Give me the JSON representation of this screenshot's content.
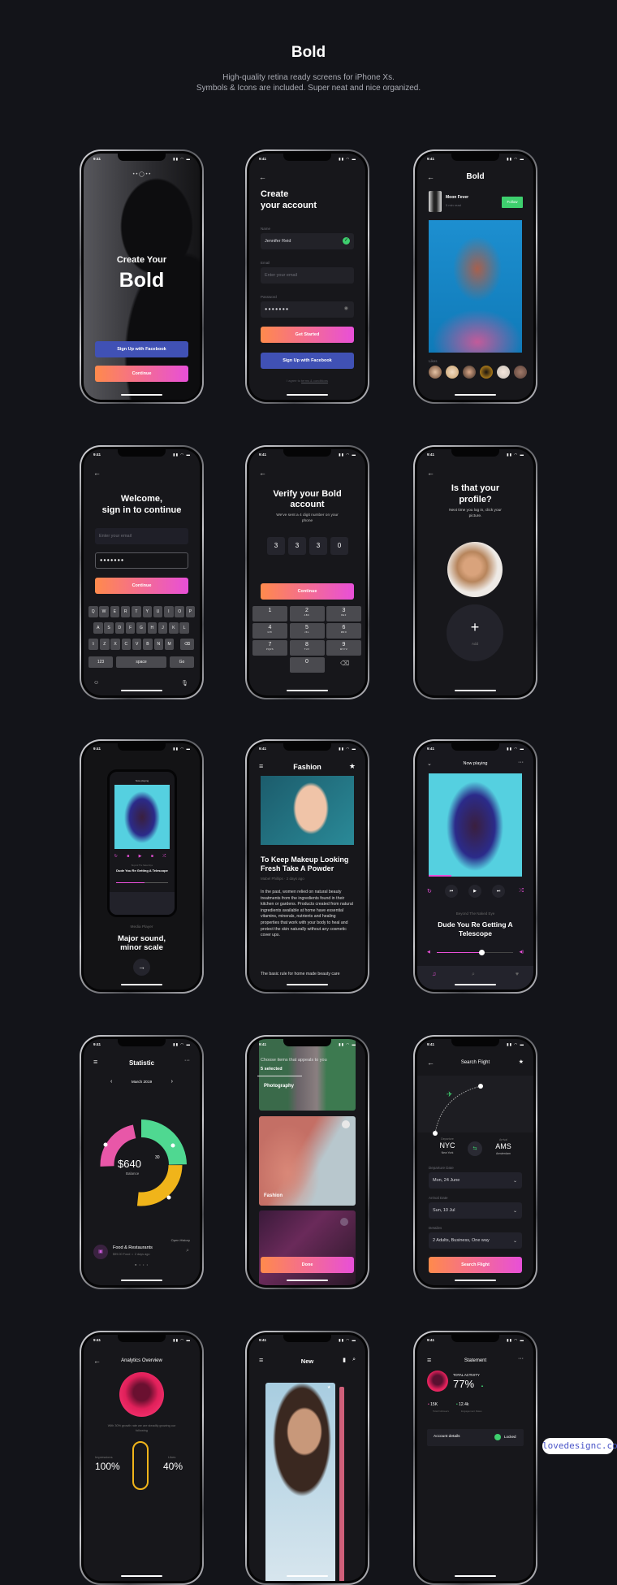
{
  "header": {
    "title": "Bold",
    "subtitle_1": "High-quality retina ready screens for iPhone Xs.",
    "subtitle_2": "Symbols & Icons are included. Super neat and nice organized."
  },
  "status_time": "9:41",
  "colors": {
    "background": "#131419",
    "accent_gradient_start": "#ff8a4c",
    "accent_gradient_end": "#e84fd8",
    "facebook": "#4051b5",
    "success": "#3ecf6e",
    "chart_pink": "#e857a8",
    "chart_green": "#4fd891",
    "chart_yellow": "#f0b41a"
  },
  "s1": {
    "title_small": "Create Your",
    "title_big": "Bold",
    "facebook_btn": "Sign Up with Facebook",
    "continue_btn": "Continue"
  },
  "s2": {
    "title_1": "Create",
    "title_2": "your account",
    "name_label": "Name",
    "name_value": "Jennifer Reid",
    "email_label": "Email",
    "email_placeholder": "Enter your email",
    "password_label": "Password",
    "password_value": "●●●●●●●",
    "get_started": "Get Started",
    "facebook_btn": "Sign Up with Facebook",
    "terms_prefix": "I agree to ",
    "terms_link": "terms & conditions"
  },
  "s3": {
    "title": "Bold",
    "author": "Moon Fever",
    "read_time": "5 min read",
    "follow": "Follow",
    "likes_label": "Likes"
  },
  "s4": {
    "title_1": "Welcome,",
    "title_2": "sign in to continue",
    "email_placeholder": "Enter your email",
    "password_value": "●●●●●●●",
    "continue_btn": "Continue",
    "keyboard": {
      "rows": [
        [
          "Q",
          "W",
          "E",
          "R",
          "T",
          "Y",
          "U",
          "I",
          "O",
          "P"
        ],
        [
          "A",
          "S",
          "D",
          "F",
          "G",
          "H",
          "J",
          "K",
          "L"
        ],
        [
          "Z",
          "X",
          "C",
          "V",
          "B",
          "N",
          "M"
        ]
      ],
      "num": "123",
      "space": "space",
      "go": "Go"
    }
  },
  "s5": {
    "title": "Verify your Bold account",
    "subtitle": "We've sent a 4 digit number on your phone",
    "code": [
      "3",
      "3",
      "3",
      "0"
    ],
    "continue_btn": "Continue",
    "numpad": [
      {
        "d": "1",
        "l": ""
      },
      {
        "d": "2",
        "l": "ABC"
      },
      {
        "d": "3",
        "l": "DEF"
      },
      {
        "d": "4",
        "l": "GHI"
      },
      {
        "d": "5",
        "l": "JKL"
      },
      {
        "d": "6",
        "l": "MNO"
      },
      {
        "d": "7",
        "l": "PQRS"
      },
      {
        "d": "8",
        "l": "TUV"
      },
      {
        "d": "9",
        "l": "WXYZ"
      },
      {
        "d": "0",
        "l": ""
      }
    ]
  },
  "s6": {
    "title_1": "Is that your",
    "title_2": "profile?",
    "subtitle": "Next time you log in, click your picture.",
    "add": "Add"
  },
  "s7": {
    "mini_header": "Now playing",
    "mini_artist": "Beyond The Naked Eye",
    "mini_song": "Dude You Re Getting A Telescope",
    "label": "Media Player",
    "title_1": "Major sound,",
    "title_2": "minor scale"
  },
  "s8": {
    "title": "Fashion",
    "article_title": "To Keep Makeup Looking Fresh Take A Powder",
    "meta": "Mabel Phillips · 2 days ago",
    "body": "In the past, women relied on natural beauty treatments from the ingredients found in their kitchen or gardens. Products created from natural ingredients available at home have essential vitamins, minerals, nutrients and healing properties that work with your body to heal and protect the skin naturally without any cosmetic cover ups.",
    "body_2": "The basic rule for home made beauty care"
  },
  "s9": {
    "header": "Now playing",
    "artist": "Beyond The Naked Eye",
    "song": "Dude You Re Getting A Telescope",
    "playback_progress": 0.24,
    "volume": 0.58
  },
  "s10": {
    "title": "Statistic",
    "month": "March 2019",
    "balance": "$640",
    "balance_cents": "30",
    "balance_label": "Balance",
    "open_history": "Open History",
    "item_title": "Food & Restaurants",
    "item_meta": "$99.00 Food  •  2 days ago"
  },
  "s11": {
    "prompt": "Choose items that appeals to you",
    "selected": "5 selected",
    "cat_1": "Photography",
    "cat_2": "Fashion",
    "done": "Done"
  },
  "s12": {
    "title": "Search Flight",
    "dep_label": "Departure",
    "dep_code": "NYC",
    "dep_city": "New York",
    "arr_label": "Arrival",
    "arr_code": "AMS",
    "arr_city": "Amsterdam",
    "dep_date_label": "Departure Date",
    "dep_date": "Mon, 24 June",
    "arr_date_label": "Arrival Date",
    "arr_date": "Sun, 10 Jul",
    "details_label": "Detailes",
    "details": "2 Adults, Business, One way",
    "search_btn": "Search Flight"
  },
  "s13": {
    "title": "Analytics Overview",
    "text": "With 30% growth rate we are steadily growing our following",
    "impressions_label": "Impressions",
    "impressions": "100%",
    "likes_label": "Likes",
    "likes": "40%"
  },
  "s14": {
    "title": "New"
  },
  "s15": {
    "title": "Statement",
    "activity_label": "TOTAL ACTIVITY",
    "activity": "77%",
    "followers": "15K",
    "followers_label": "Total Followers",
    "engagement": "12.4k",
    "engagement_label": "Engagement Rates",
    "account": "Account details",
    "locked": "Locked"
  },
  "watermark": "lovedesignc.com"
}
